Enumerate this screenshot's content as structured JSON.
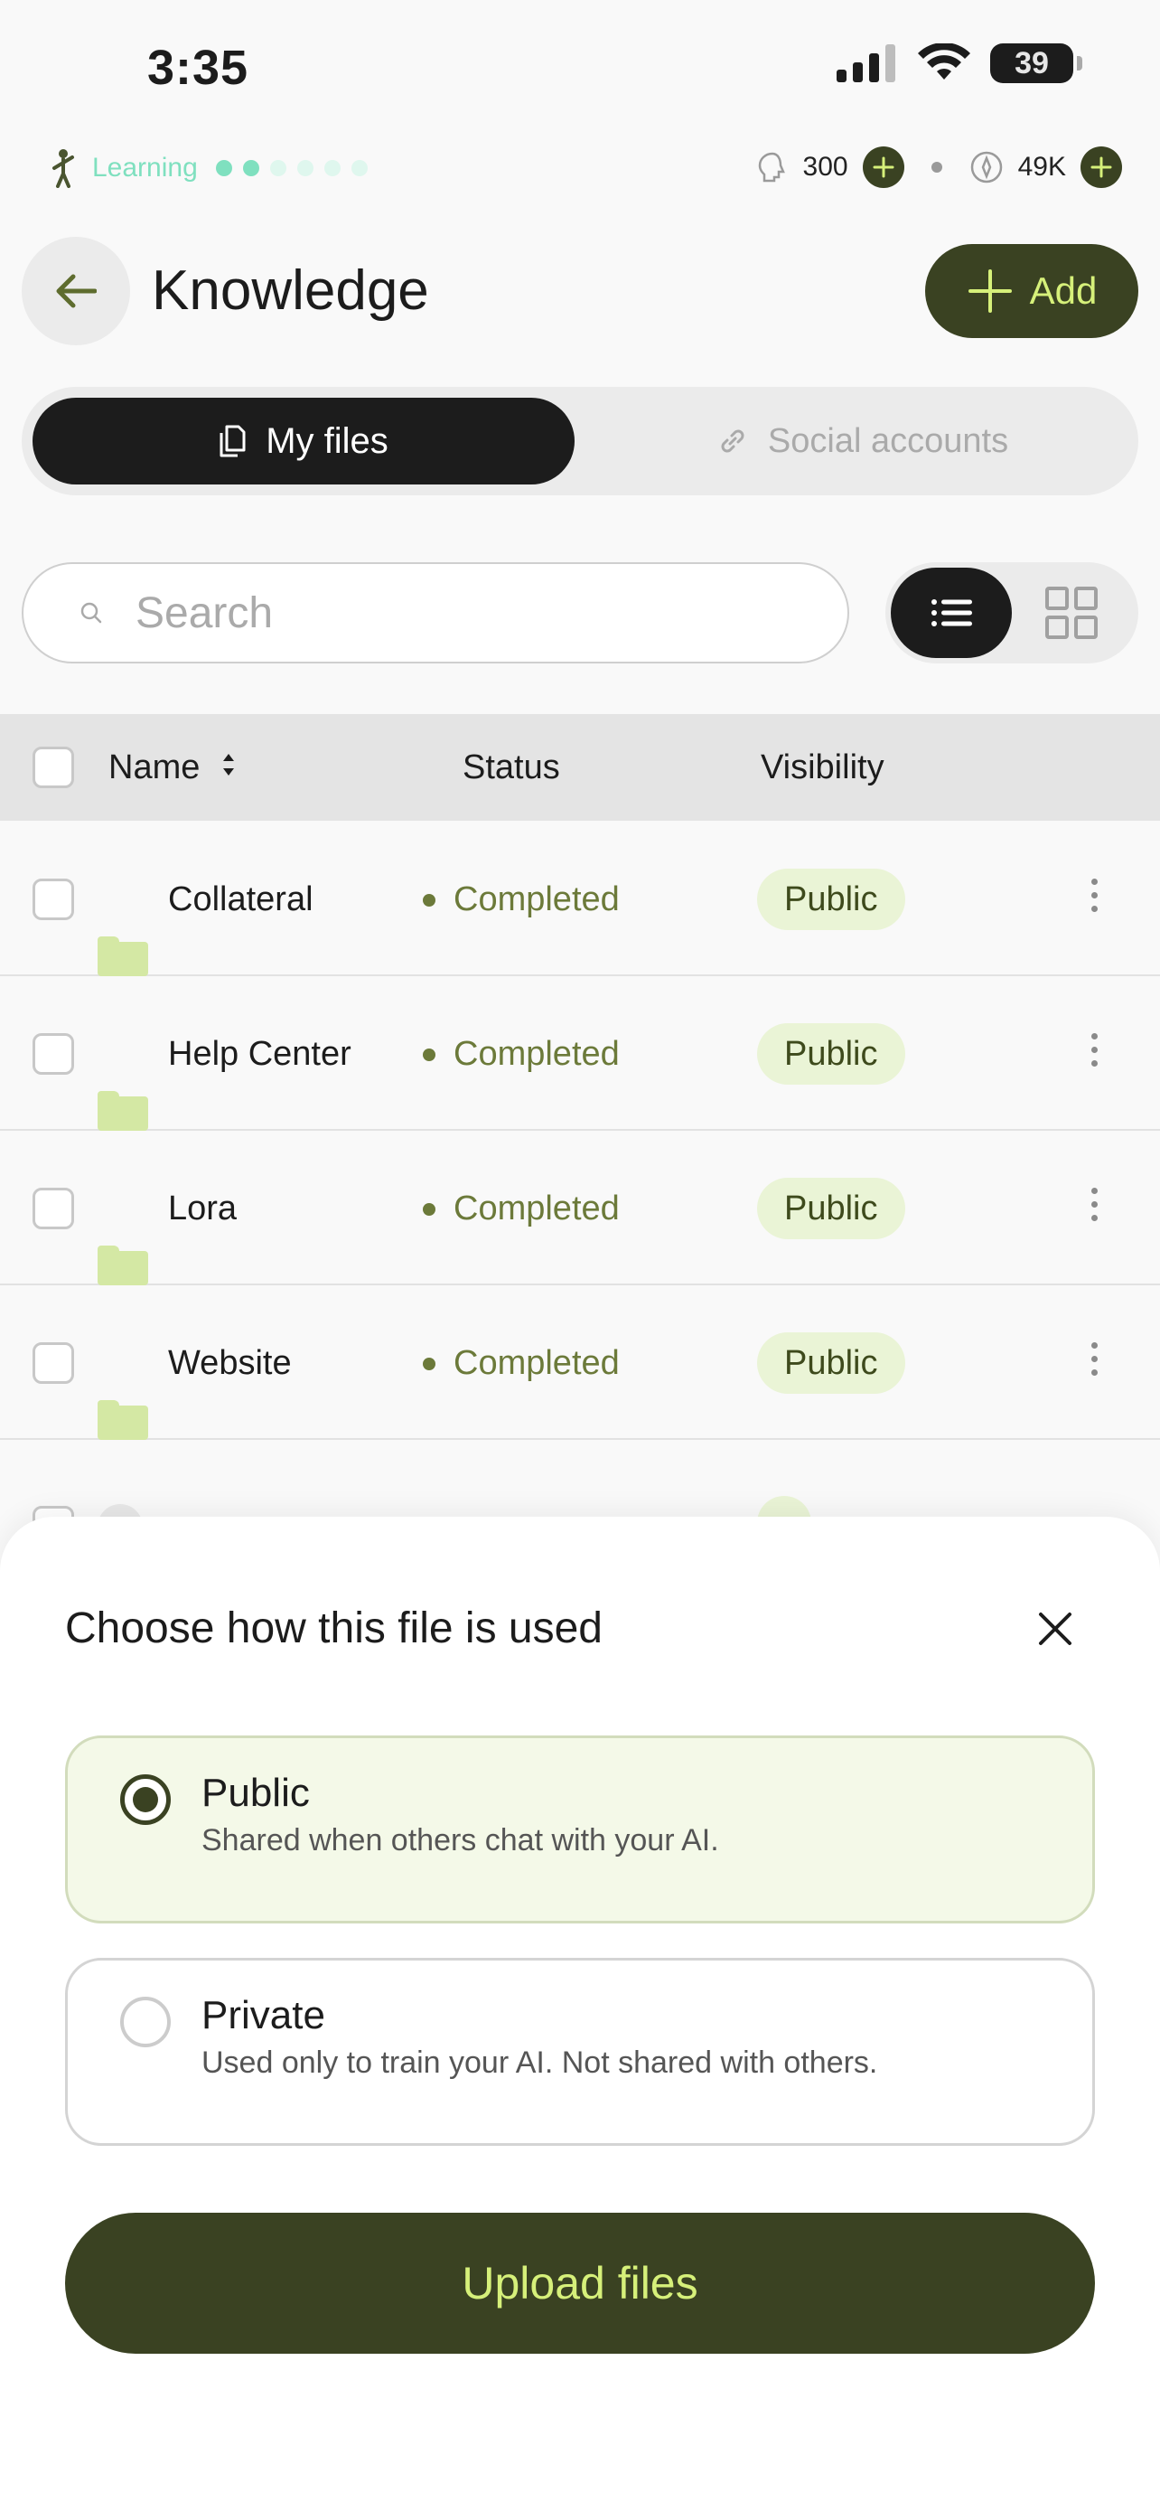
{
  "status_bar": {
    "time": "3:35",
    "battery": "39"
  },
  "progress": {
    "label": "Learning",
    "dots_total": 6,
    "dots_filled": 2
  },
  "credits": {
    "primary": "300",
    "secondary": "49K"
  },
  "header": {
    "title": "Knowledge",
    "add_label": "Add"
  },
  "tabs": {
    "active": "My files",
    "inactive": "Social accounts"
  },
  "search": {
    "placeholder": "Search"
  },
  "table": {
    "headers": {
      "name": "Name",
      "status": "Status",
      "visibility": "Visibility"
    },
    "rows": [
      {
        "name": "Collateral",
        "status": "Completed",
        "visibility": "Public"
      },
      {
        "name": "Help Center",
        "status": "Completed",
        "visibility": "Public"
      },
      {
        "name": "Lora",
        "status": "Completed",
        "visibility": "Public"
      },
      {
        "name": "Website",
        "status": "Completed",
        "visibility": "Public"
      }
    ]
  },
  "sheet": {
    "title": "Choose how this file is used",
    "options": [
      {
        "title": "Public",
        "description": "Shared when others chat with your AI.",
        "selected": true
      },
      {
        "title": "Private",
        "description": "Used only to train your AI. Not shared with others.",
        "selected": false
      }
    ],
    "upload_label": "Upload files"
  },
  "colors": {
    "accent_dark": "#3a4222",
    "accent_lime": "#d6f07a",
    "status_green": "#6c7a3a",
    "progress_mint": "#7fe0bf"
  }
}
